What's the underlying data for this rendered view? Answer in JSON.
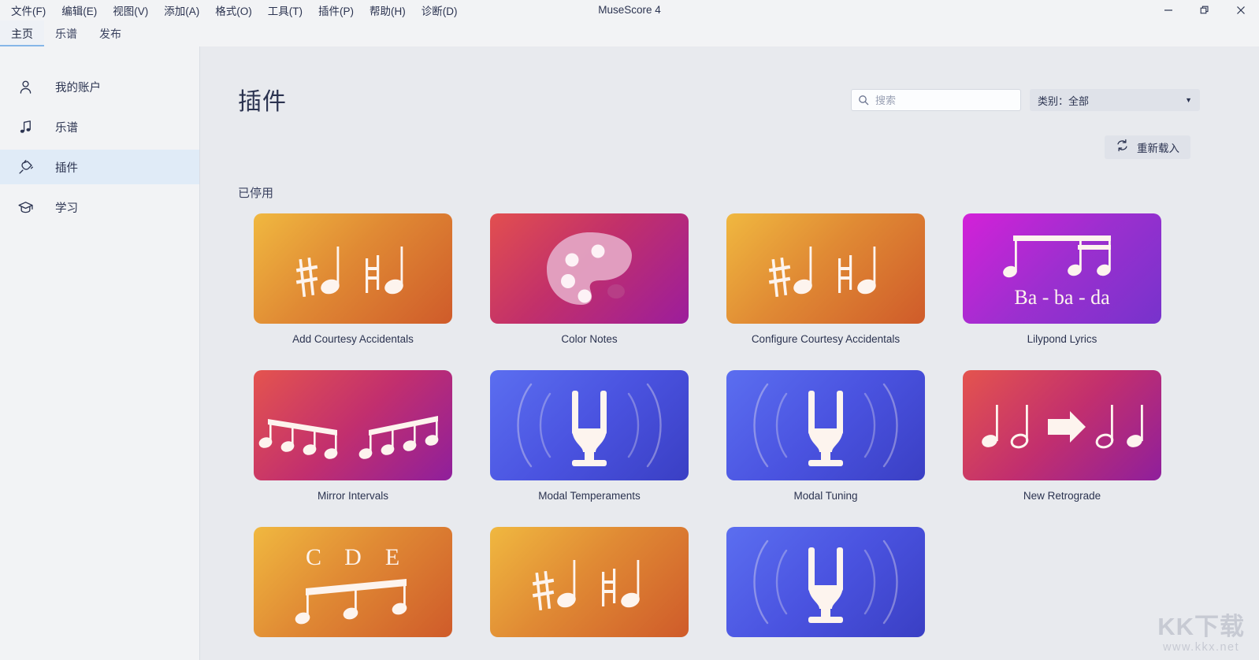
{
  "window": {
    "title": "MuseScore 4",
    "controls": [
      {
        "name": "minimize",
        "glyph": "minimize-icon"
      },
      {
        "name": "restore",
        "glyph": "restore-icon"
      },
      {
        "name": "close",
        "glyph": "close-icon"
      }
    ]
  },
  "menubar": [
    {
      "label": "文件(F)"
    },
    {
      "label": "编辑(E)"
    },
    {
      "label": "视图(V)"
    },
    {
      "label": "添加(A)"
    },
    {
      "label": "格式(O)"
    },
    {
      "label": "工具(T)"
    },
    {
      "label": "插件(P)"
    },
    {
      "label": "帮助(H)"
    },
    {
      "label": "诊断(D)"
    }
  ],
  "tabs": [
    {
      "label": "主页",
      "active": true
    },
    {
      "label": "乐谱",
      "active": false
    },
    {
      "label": "发布",
      "active": false
    }
  ],
  "sidebar": {
    "items": [
      {
        "label": "我的账户",
        "icon": "person-icon",
        "selected": false
      },
      {
        "label": "乐谱",
        "icon": "music-note-icon",
        "selected": false
      },
      {
        "label": "插件",
        "icon": "plug-icon",
        "selected": true
      },
      {
        "label": "学习",
        "icon": "graduation-cap-icon",
        "selected": false
      }
    ]
  },
  "main": {
    "page_title": "插件",
    "search": {
      "value": "",
      "placeholder": "搜索",
      "icon": "search-icon"
    },
    "category": {
      "label": "类别：全部",
      "caret": "chevron-down-icon"
    },
    "reload_button": {
      "label": "重新载入",
      "icon": "refresh-icon"
    },
    "section_title": "已停用",
    "plugins": [
      {
        "name": "Add Courtesy Accidentals",
        "art": "accidentals",
        "theme": "g-orange"
      },
      {
        "name": "Color Notes",
        "art": "palette",
        "theme": "g-redpurp"
      },
      {
        "name": "Configure Courtesy Accidentals",
        "art": "accidentals",
        "theme": "g-orange"
      },
      {
        "name": "Lilypond Lyrics",
        "art": "lyrics",
        "theme": "g-magenta",
        "lyric_text": "Ba - ba - da"
      },
      {
        "name": "Mirror Intervals",
        "art": "mirror",
        "theme": "g-crimson"
      },
      {
        "name": "Modal Temperaments",
        "art": "tuningfork",
        "theme": "g-blue"
      },
      {
        "name": "Modal Tuning",
        "art": "tuningfork",
        "theme": "g-blue"
      },
      {
        "name": "New Retrograde",
        "art": "retrograde",
        "theme": "g-crimson"
      },
      {
        "name": "",
        "art": "notenames",
        "theme": "g-orange",
        "note_letters": [
          "C",
          "D",
          "E"
        ]
      },
      {
        "name": "",
        "art": "accidentals",
        "theme": "g-orange"
      },
      {
        "name": "",
        "art": "tuningfork",
        "theme": "g-blue"
      }
    ]
  },
  "overlay_logo": {
    "name": "app-badge-logo"
  },
  "watermark": {
    "big": "KK下载",
    "small": "www.kkx.net"
  },
  "colors": {
    "accent": "#86b6e8",
    "selection": "#e0ebf7",
    "text": "#2b3350",
    "content_bg": "#e8eaee",
    "chrome_bg": "#f2f3f5"
  }
}
